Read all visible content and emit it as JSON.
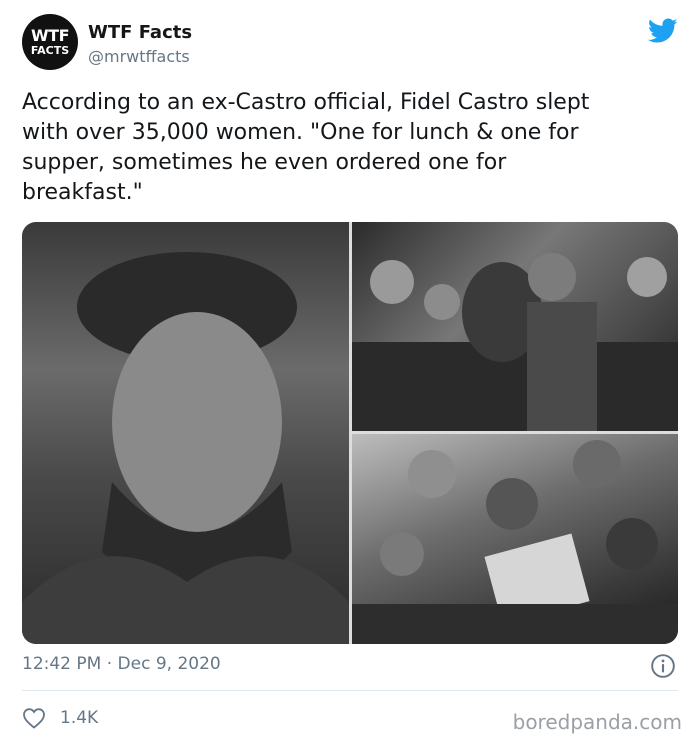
{
  "author": {
    "display_name": "WTF Facts",
    "handle": "@mrwtffacts",
    "avatar_line1": "WTF",
    "avatar_line2": "FACTS"
  },
  "tweet": {
    "text": "According to an ex-Castro official, Fidel Castro slept\nwith over 35,000 women. \"One for lunch & one for\nsupper, sometimes he even ordered one for\nbreakfast.\""
  },
  "meta": {
    "timestamp": "12:42 PM · Dec 9, 2020",
    "like_count": "1.4K"
  },
  "watermark": "boredpanda.com",
  "icons": {
    "brand": "twitter-bird-icon",
    "info": "info-icon",
    "like": "heart-icon"
  },
  "colors": {
    "twitter_blue": "#1DA1F2",
    "text": "#14171a",
    "muted": "#657786"
  }
}
